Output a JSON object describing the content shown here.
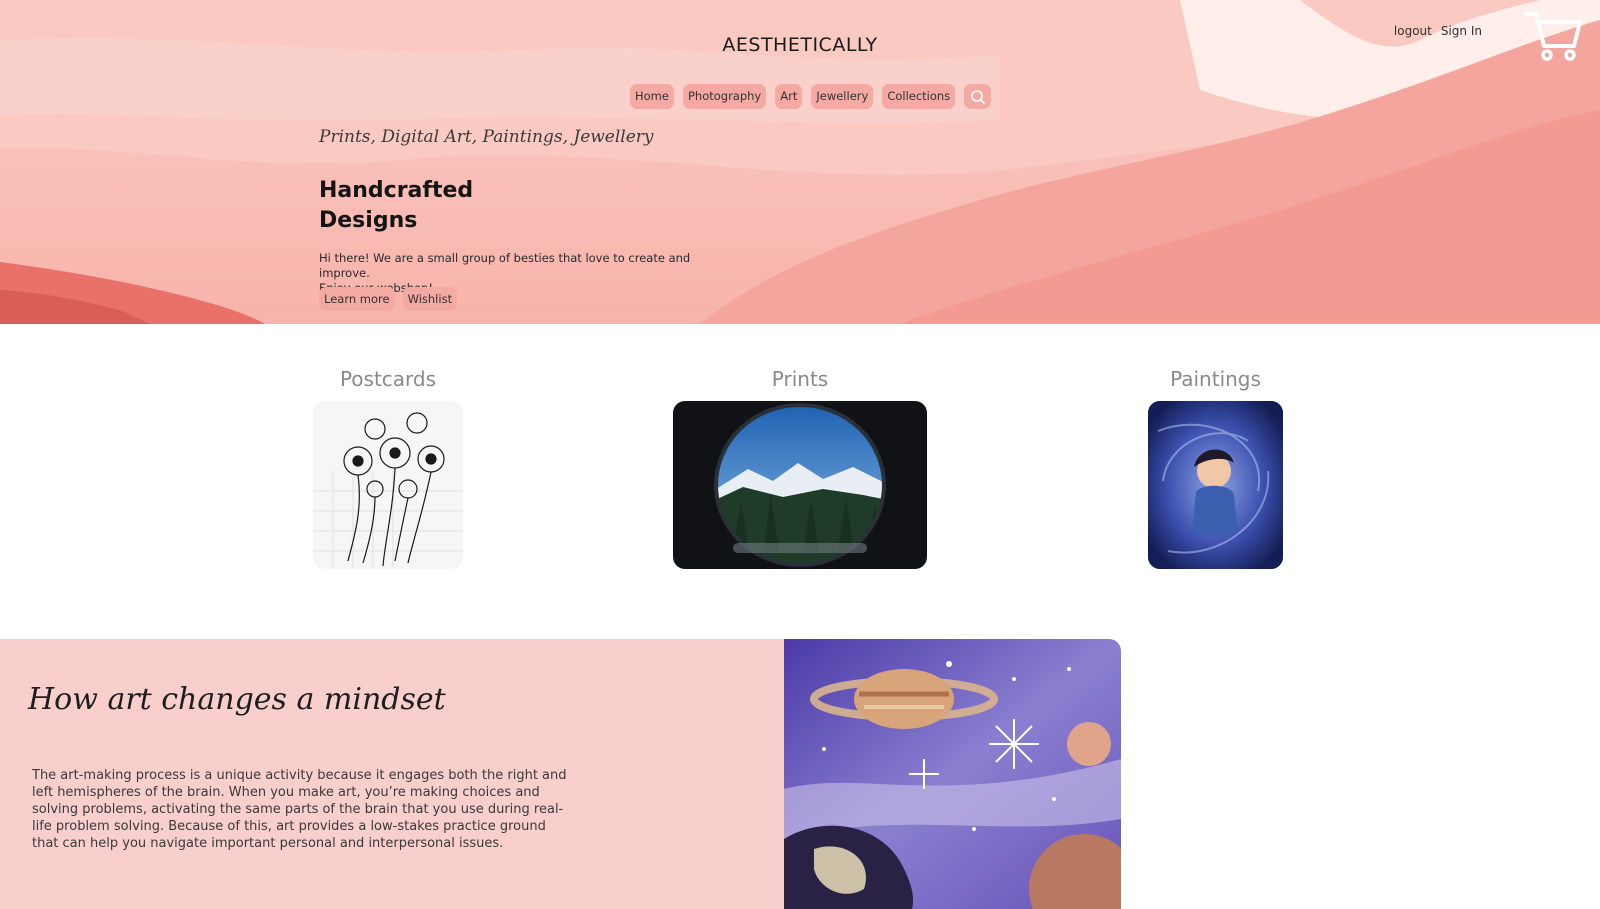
{
  "header": {
    "brand": "AESTHETICALLY",
    "logout_label": "logout",
    "signin_label": "Sign In",
    "cart_icon": "cart-icon"
  },
  "nav": {
    "items": [
      "Home",
      "Photography",
      "Art",
      "Jewellery",
      "Collections"
    ],
    "search_icon": "search-icon"
  },
  "hero": {
    "tagline": "Prints, Digital Art, Paintings, Jewellery",
    "headline_line1": "Handcrafted",
    "headline_line2": "Designs",
    "intro_line1": "Hi there! We are a small group of besties that love to create and improve.",
    "intro_line2": "Enjoy our webshop!",
    "learn_more_label": "Learn more",
    "wishlist_label": "Wishlist"
  },
  "categories": [
    {
      "title": "Postcards"
    },
    {
      "title": "Prints"
    },
    {
      "title": "Paintings"
    }
  ],
  "article": {
    "title": "How art changes a mindset",
    "body": "The art-making process is a unique activity because it engages both the right and left hemispheres of the brain. When you make art, you’re making choices and solving problems, activating the same parts of the brain that you use during real-life problem solving. Because of this, art provides a low-stakes practice ground that can help you navigate important personal and interpersonal issues."
  },
  "colors": {
    "hero_pink": "#f7b6b0",
    "button_pink": "#f4a9a2",
    "article_bg": "#f8cfcd",
    "category_title": "#8a8a8a"
  }
}
